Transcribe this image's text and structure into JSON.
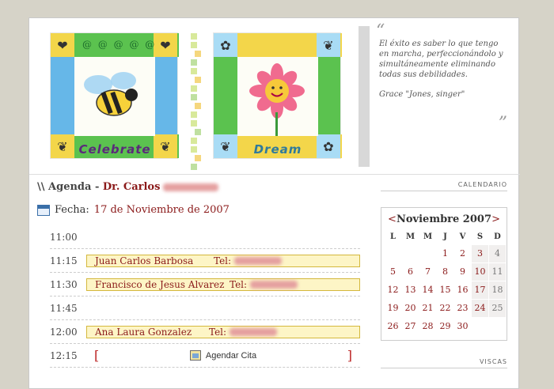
{
  "banner": {
    "card1_word": "Celebrate",
    "card2_word": "Dream"
  },
  "quote": {
    "text": "El éxito es saber lo que tengo en marcha, perfeccionándolo y simultáneamente eliminando todas sus debilidades.",
    "author": "Grace \"Jones, singer\"",
    "open_mark": "“",
    "close_mark": "”"
  },
  "agenda": {
    "prefix": "\\\\ Agenda - ",
    "doctor": "Dr. Carlos",
    "fecha_label": "Fecha:",
    "fecha_value": "17 de Noviembre de 2007",
    "slots": [
      {
        "time": "11:00"
      },
      {
        "time": "11:15",
        "name": "Juan Carlos Barbosa",
        "tel": "Tel:"
      },
      {
        "time": "11:30",
        "name": "Francisco de Jesus Alvarez",
        "tel": "Tel:"
      },
      {
        "time": "11:45"
      },
      {
        "time": "12:00",
        "name": "Ana Laura Gonzalez",
        "tel": "Tel:"
      },
      {
        "time": "12:15",
        "action": "Agendar Cita",
        "open": "[",
        "close": "]"
      }
    ]
  },
  "sidebar": {
    "calendar_title": "CALENDARIO",
    "viscas_title": "VISCAS"
  },
  "calendar": {
    "month": "Noviembre 2007",
    "prev": "<",
    "next": ">",
    "dow": [
      "L",
      "M",
      "M",
      "J",
      "V",
      "S",
      "D"
    ],
    "days": [
      "",
      "",
      "",
      "1",
      "2",
      "3",
      "4",
      "5",
      "6",
      "7",
      "8",
      "9",
      "10",
      "11",
      "12",
      "13",
      "14",
      "15",
      "16",
      "17",
      "18",
      "19",
      "20",
      "21",
      "22",
      "23",
      "24",
      "25",
      "26",
      "27",
      "28",
      "29",
      "30",
      "",
      ""
    ]
  }
}
